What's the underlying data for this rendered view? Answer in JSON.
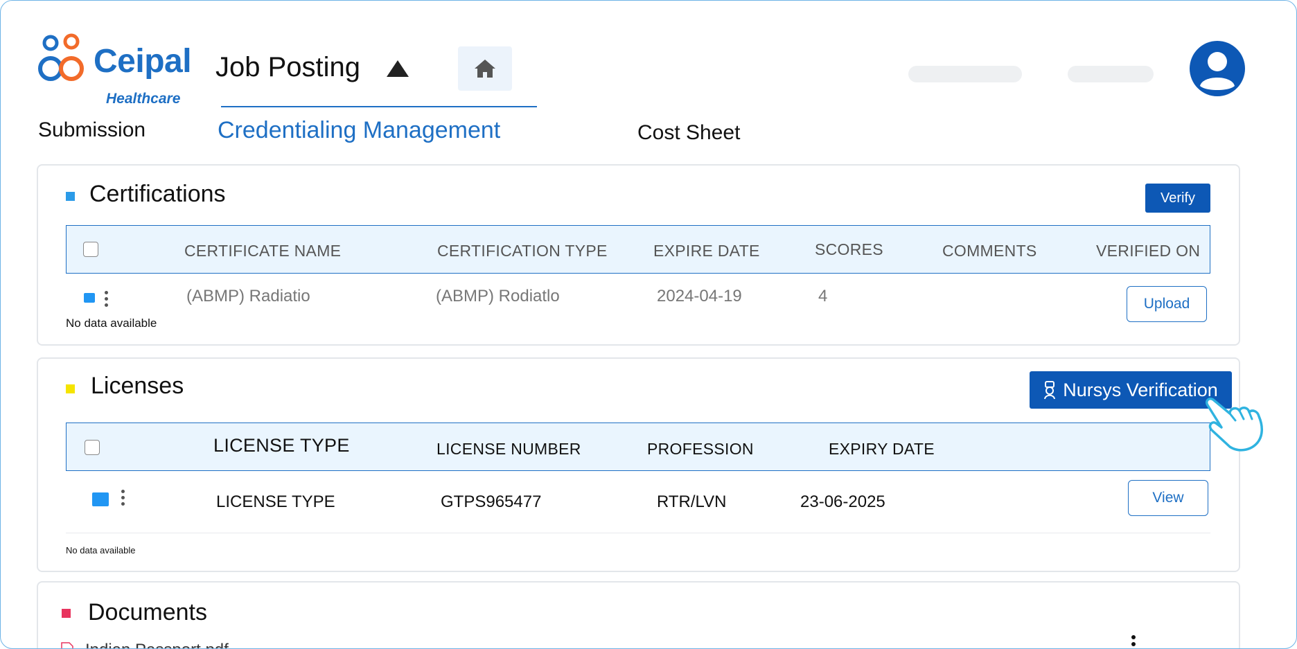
{
  "header": {
    "logo_text": "Ceipal",
    "logo_sub": "Healthcare",
    "title": "Job Posting",
    "brand_color": "#1e6fc4"
  },
  "tabs": [
    {
      "label": "Submission"
    },
    {
      "label": "Credentialing Management",
      "active": true
    },
    {
      "label": "Cost Sheet"
    }
  ],
  "certifications": {
    "title": "Certifications",
    "marker_color": "#2b9be8",
    "verify_label": "Verify",
    "columns": [
      "CERTIFICATE NAME",
      "CERTIFICATION TYPE",
      "EXPIRE DATE",
      "SCORES",
      "COMMENTS",
      "VERIFIED ON"
    ],
    "rows": [
      {
        "name": "(ABMP) Radiatio",
        "type": "(ABMP) Rodiatlo",
        "expire": "2024-04-19",
        "score": "4",
        "comments": "",
        "action": "Upload"
      }
    ],
    "no_data": "No data available"
  },
  "licenses": {
    "title": "Licenses",
    "marker_color": "#f5e400",
    "nursys_label": "Nursys Verification",
    "columns": [
      "LICENSE TYPE",
      "LICENSE NUMBER",
      "PROFESSION",
      "EXPIRY DATE"
    ],
    "rows": [
      {
        "type": "LICENSE TYPE",
        "number": "GTPS965477",
        "profession": "RTR/LVN",
        "expiry": "23-06-2025",
        "action": "View"
      }
    ],
    "no_data": "No data available"
  },
  "documents": {
    "title": "Documents",
    "marker_color": "#e8345e",
    "first_file": "Indian Passport.pdf"
  }
}
